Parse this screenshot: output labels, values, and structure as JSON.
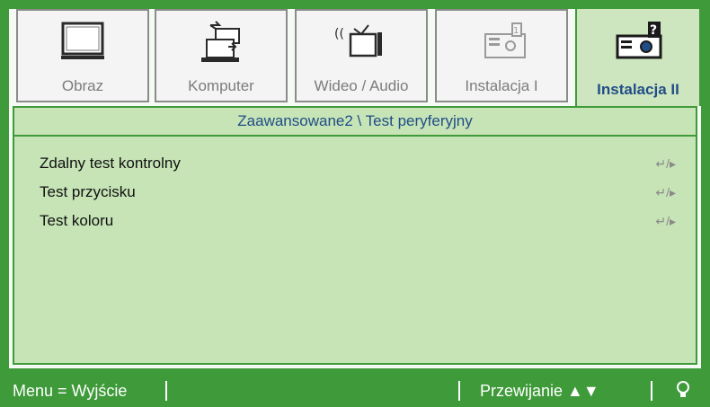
{
  "tabs": [
    {
      "label": "Obraz",
      "icon": "monitor-icon"
    },
    {
      "label": "Komputer",
      "icon": "laptop-icon"
    },
    {
      "label": "Wideo / Audio",
      "icon": "tv-audio-icon"
    },
    {
      "label": "Instalacja I",
      "icon": "projector-icon"
    },
    {
      "label": "Instalacja II",
      "icon": "projector-question-icon",
      "active": true
    }
  ],
  "breadcrumb": "Zaawansowane2 \\ Test peryferyjny",
  "items": [
    {
      "label": "Zdalny test kontrolny",
      "icon": "enter-arrow-icon",
      "icon_text": "↵/▸"
    },
    {
      "label": "Test przycisku",
      "icon": "enter-arrow-icon",
      "icon_text": "↵/▸"
    },
    {
      "label": "Test koloru",
      "icon": "enter-arrow-icon",
      "icon_text": "↵/▸"
    }
  ],
  "footer": {
    "menu_exit": "Menu = Wyjście",
    "scroll": "Przewijanie ▲▼",
    "icon": "bulb-icon"
  },
  "colors": {
    "frame_green": "#3f9a3a",
    "panel_green": "#c6e4b6",
    "active_tab_text": "#214d87"
  }
}
